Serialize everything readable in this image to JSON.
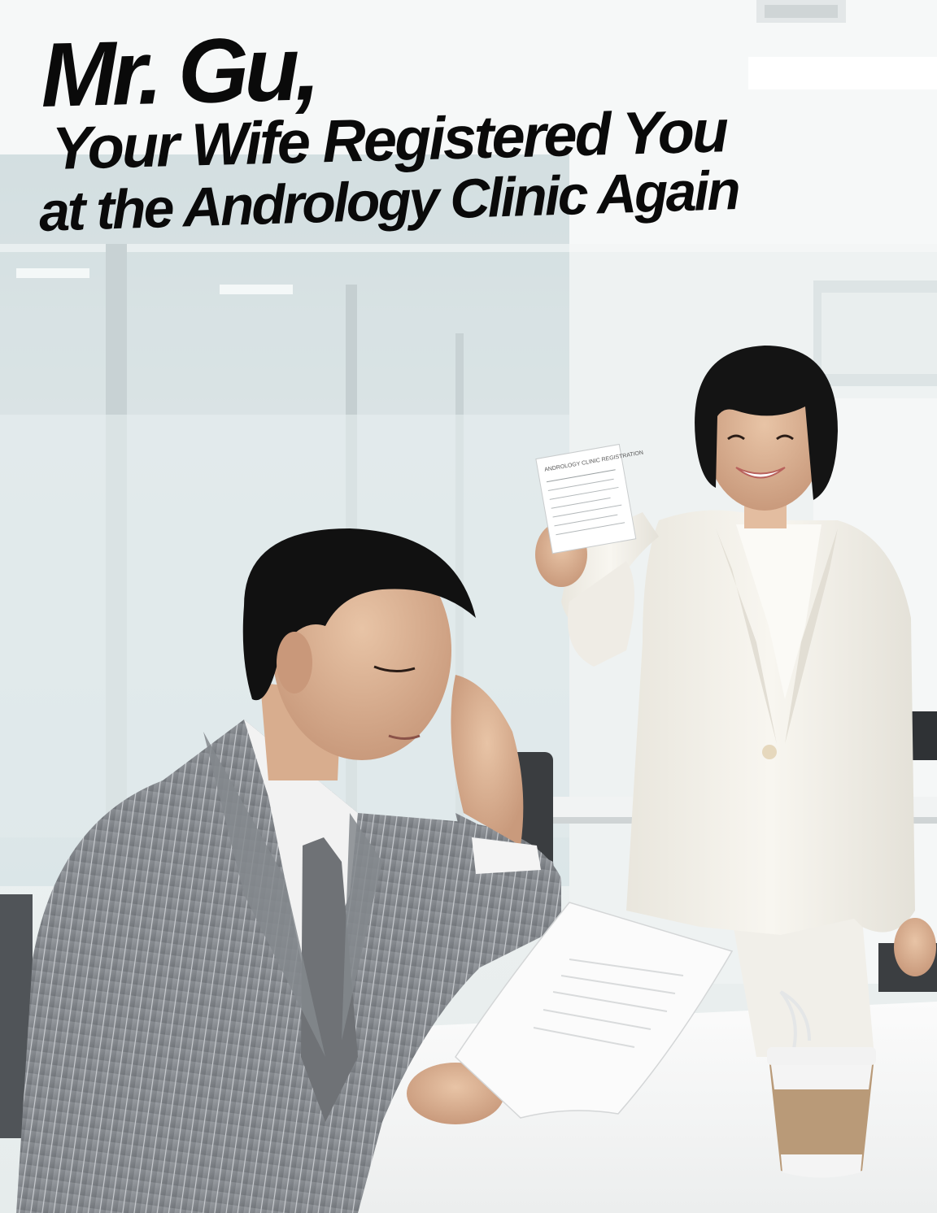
{
  "poster": {
    "title_line1": "Mr. Gu,",
    "title_line2": "Your Wife Registered You",
    "title_line3": "at the Andrology Clinic Again"
  },
  "scene": {
    "note_text": "ANDROLOGY CLINIC REGISTRATION",
    "colors": {
      "wall": "#f2f5f5",
      "glass": "#dfe9ea",
      "suit_gray": "#8b8f94",
      "blazer_white": "#f4f2ec",
      "cup_sleeve": "#b99a78",
      "desk": "#f7f7f7"
    }
  }
}
